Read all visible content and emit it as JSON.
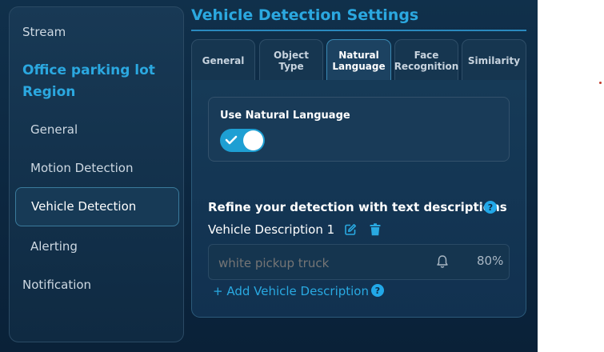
{
  "sidebar": {
    "stream": "Stream",
    "region": "Office parking lot Region",
    "items": [
      "General",
      "Motion Detection",
      "Vehicle Detection",
      "Alerting"
    ],
    "notification": "Notification",
    "active_item": "Vehicle Detection"
  },
  "page": {
    "title": "Vehicle Detection Settings"
  },
  "tabs": [
    {
      "line1": "General",
      "line2": ""
    },
    {
      "line1": "Object",
      "line2": "Type"
    },
    {
      "line1": "Natural",
      "line2": "Language"
    },
    {
      "line1": "Face",
      "line2": "Recognition"
    },
    {
      "line1": "Similarity",
      "line2": ""
    }
  ],
  "active_tab": "Natural Language",
  "natural_language": {
    "label": "Use Natural Language",
    "enabled": true
  },
  "refine": {
    "heading": "Refine your detection with text descriptions",
    "help": "?"
  },
  "description": {
    "label": "Vehicle Description 1",
    "placeholder": "white pickup truck",
    "value": "",
    "confidence": "80%",
    "icons": [
      "edit-icon",
      "trash-icon",
      "bell-icon"
    ]
  },
  "add_description": {
    "label": "+ Add Vehicle Description",
    "help": "?"
  },
  "colors": {
    "accent": "#2ba8e0",
    "toggle_on": "#1e9fd3",
    "background": "#0c2740"
  }
}
